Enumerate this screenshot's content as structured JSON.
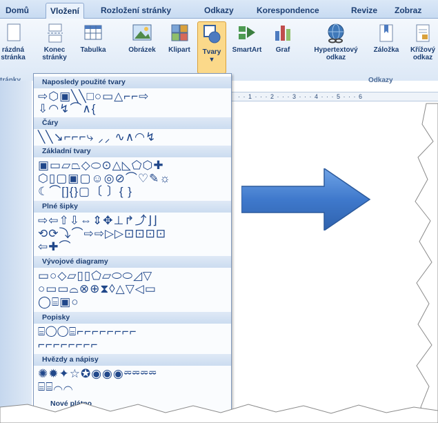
{
  "tabs": [
    "Domů",
    "Vložení",
    "Rozložení stránky",
    "Odkazy",
    "Korespondence",
    "Revize",
    "Zobraz"
  ],
  "ribbon": {
    "buttons": [
      {
        "label1": "rázdná",
        "label2": "stránka"
      },
      {
        "label1": "Konec",
        "label2": "stránky"
      },
      {
        "label1": "Tabulka",
        "label2": ""
      },
      {
        "label1": "Obrázek",
        "label2": ""
      },
      {
        "label1": "Klipart",
        "label2": ""
      },
      {
        "label1": "Tvary",
        "label2": ""
      },
      {
        "label1": "SmartArt",
        "label2": ""
      },
      {
        "label1": "Graf",
        "label2": ""
      },
      {
        "label1": "Hypertextový",
        "label2": "odkaz"
      },
      {
        "label1": "Záložka",
        "label2": ""
      },
      {
        "label1": "Křížový",
        "label2": "odkaz"
      }
    ],
    "group_left": "tránky",
    "group_odkazy": "Odkazy"
  },
  "ruler_text": "· · 1 · · · 2 · · · 3 · · · 4 · · · 5 · · · 6",
  "gallery": {
    "sections": [
      {
        "title": "Naposledy použité tvary",
        "rows": [
          "⇨⬡▣╲╲□○▭△⌐⌐⇨",
          "⇩◠↯⌒∧{"
        ]
      },
      {
        "title": "Čáry",
        "rows": [
          "╲╲↘⌐⌐⌐⤷ ⸝⸝ ∿∧◠↯"
        ]
      },
      {
        "title": "Základní tvary",
        "rows": [
          "▣▭▱⏢◇⬭⊙△◺⬠⬡✚",
          "⬡▯▢▣▢☺◎⊘⌒♡✎☼",
          "☾⌒[]{}▢〔 〕{ }"
        ]
      },
      {
        "title": "Plné šipky",
        "rows": [
          "⇨⇦⇧⇩⇔⇕✥⊥↱⤴⌋⌋",
          "⟲⟳⤵⌒⇨⇨▷▷⊡⊡⊡⊡",
          "⇦✚⌒"
        ]
      },
      {
        "title": "Vývojové diagramy",
        "rows": [
          "▭○◇▱▯▯⬠▱⬭⬭◿▽",
          "○▭▭⌓⊗⊕⧗◊△▽◁▭",
          "◯⌸▣○"
        ]
      },
      {
        "title": "Popisky",
        "rows": [
          "⌸◯◯⌸⌐⌐⌐⌐⌐⌐⌐⌐",
          "⌐⌐⌐⌐⌐⌐⌐⌐"
        ]
      },
      {
        "title": "Hvězdy a nápisy",
        "rows": [
          "✺✹✦☆✪◉◉◉⏔⏔⏔⏔",
          "⌸⌸⌒⌒"
        ]
      },
      {
        "title": "Nové plátno",
        "rows": []
      }
    ]
  },
  "colors": {
    "accent": "#20478a",
    "arrow": "#4a86d6",
    "ribbon": "#dce8f6"
  }
}
